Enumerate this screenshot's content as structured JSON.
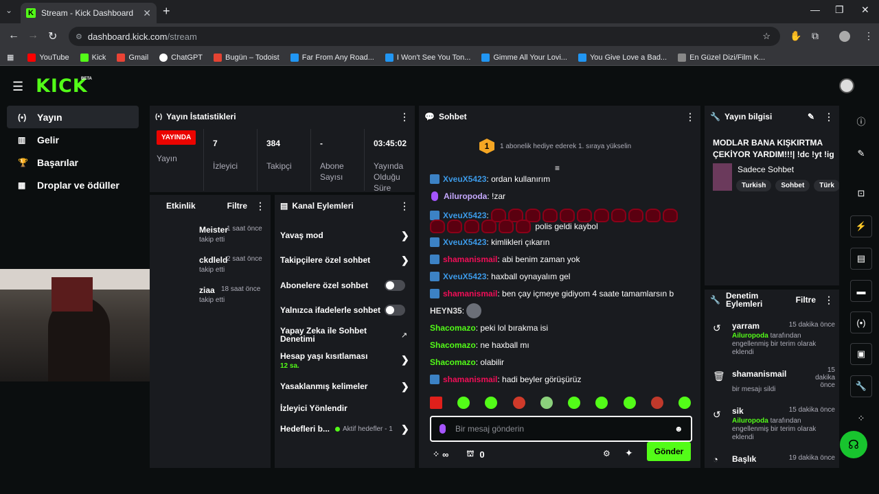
{
  "browser": {
    "tab_title": "Stream - Kick Dashboard",
    "url_host": "dashboard.kick.com",
    "url_path": "/stream",
    "bookmarks": [
      {
        "label": "YouTube",
        "color": "#ff0000"
      },
      {
        "label": "Kick",
        "color": "#53fc18"
      },
      {
        "label": "Gmail",
        "color": "#ea4335"
      },
      {
        "label": "ChatGPT",
        "color": "#ffffff"
      },
      {
        "label": "Bugün – Todoist",
        "color": "#e44332"
      },
      {
        "label": "Far From Any Road...",
        "color": "#2196f3"
      },
      {
        "label": "I Won't See You Ton...",
        "color": "#2196f3"
      },
      {
        "label": "Gimme All Your Lovi...",
        "color": "#2196f3"
      },
      {
        "label": "You Give Love a Bad...",
        "color": "#2196f3"
      },
      {
        "label": "En Güzel Dizi/Film K...",
        "color": "#888888"
      }
    ]
  },
  "app": {
    "logo": "KICK",
    "beta": "BETA"
  },
  "sidenav": [
    {
      "label": "Yayın",
      "icon": "broadcast-icon"
    },
    {
      "label": "Gelir",
      "icon": "revenue-icon"
    },
    {
      "label": "Başarılar",
      "icon": "trophy-icon"
    },
    {
      "label": "Droplar ve ödüller",
      "icon": "gift-icon"
    }
  ],
  "stats": {
    "title": "Yayın İstatistikleri",
    "live_badge": "YAYINDA",
    "live_label": "Yayın",
    "viewers_value": "7",
    "viewers_label": "İzleyici",
    "followers_value": "384",
    "followers_label": "Takipçi",
    "subs_value": "-",
    "subs_label": "Abone Sayısı",
    "duration_value": "03:45:02",
    "duration_label": "Yayında Olduğu Süre"
  },
  "activity": {
    "title": "Etkinlik",
    "filter": "Filtre",
    "items": [
      {
        "name": "Meister",
        "time": "1 saat önce",
        "action": "takip etti"
      },
      {
        "name": "ckdleld",
        "time": "2 saat önce",
        "action": "takip etti"
      },
      {
        "name": "ziaa",
        "time": "18 saat önce",
        "action": "takip etti"
      }
    ]
  },
  "actions": {
    "title": "Kanal Eylemleri",
    "slow_mode": "Yavaş mod",
    "followers_only": "Takipçilere özel sohbet",
    "subs_only": "Abonelere özel sohbet",
    "emotes_only": "Yalnızca ifadelerle sohbet",
    "ai_moderation": "Yapay Zeka ile Sohbet Denetimi",
    "account_age": "Hesap yaşı kısıtlaması",
    "account_age_value": "12 sa.",
    "banned_words": "Yasaklanmış kelimeler",
    "raid": "İzleyici Yönlendir",
    "goals": "Hedefleri b...",
    "goals_status": "Aktif hedefler - 1"
  },
  "chat": {
    "title": "Sohbet",
    "gift_rank": "1",
    "gift_text": "1 abonelik hediye ederek 1. sıraya yükselin",
    "messages": [
      {
        "user": "XveuX5423",
        "text": "ordan kullanırım"
      },
      {
        "user": "Ailuropoda",
        "text": "!zar"
      },
      {
        "user": "XveuX5423",
        "text": "polis geldi kaybol"
      },
      {
        "user": "XveuX5423",
        "text": "kimlikleri çıkarın"
      },
      {
        "user": "shamanismail",
        "text": "abi benim zaman yok"
      },
      {
        "user": "XveuX5423",
        "text": "haxball oynayalım gel"
      },
      {
        "user": "shamanismail",
        "text": "ben çay içmeye gidiyom 4 saate tamamlarsın b"
      },
      {
        "user": "HEYN35",
        "text": ""
      },
      {
        "user": "Shacomazo",
        "text": "peki lol bırakma isi"
      },
      {
        "user": "Shacomazo",
        "text": "ne haxball mı"
      },
      {
        "user": "Shacomazo",
        "text": "olabilir"
      },
      {
        "user": "shamanismail",
        "text": "hadi beyler görüşürüz"
      }
    ],
    "input_placeholder": "Bir mesaj gönderin",
    "points": "∞",
    "gift_count": "0",
    "send": "Gönder"
  },
  "info": {
    "title": "Yayın bilgisi",
    "stream_title": "MODLAR BANA KIŞKIRTMA ÇEKİYOR YARDIM!!!| !dc !yt !ig",
    "category": "Sadece Sohbet",
    "tags": [
      "Turkish",
      "Sohbet",
      "Türk"
    ]
  },
  "moderation": {
    "title": "Denetim Eylemleri",
    "filter": "Filtre",
    "entries": [
      {
        "name": "yarram",
        "time": "15 dakika önce",
        "mod": "Ailuropoda",
        "desc": "tarafından engellenmiş bir terim olarak eklendi"
      },
      {
        "name": "shamanismail",
        "time": "15 dakika önce",
        "desc": "bir mesajı sildi"
      },
      {
        "name": "sik",
        "time": "15 dakika önce",
        "mod": "Ailuropoda",
        "desc": "tarafından engellenmiş bir terim olarak eklendi"
      },
      {
        "name": "Başlık",
        "time": "19 dakika önce"
      }
    ]
  }
}
